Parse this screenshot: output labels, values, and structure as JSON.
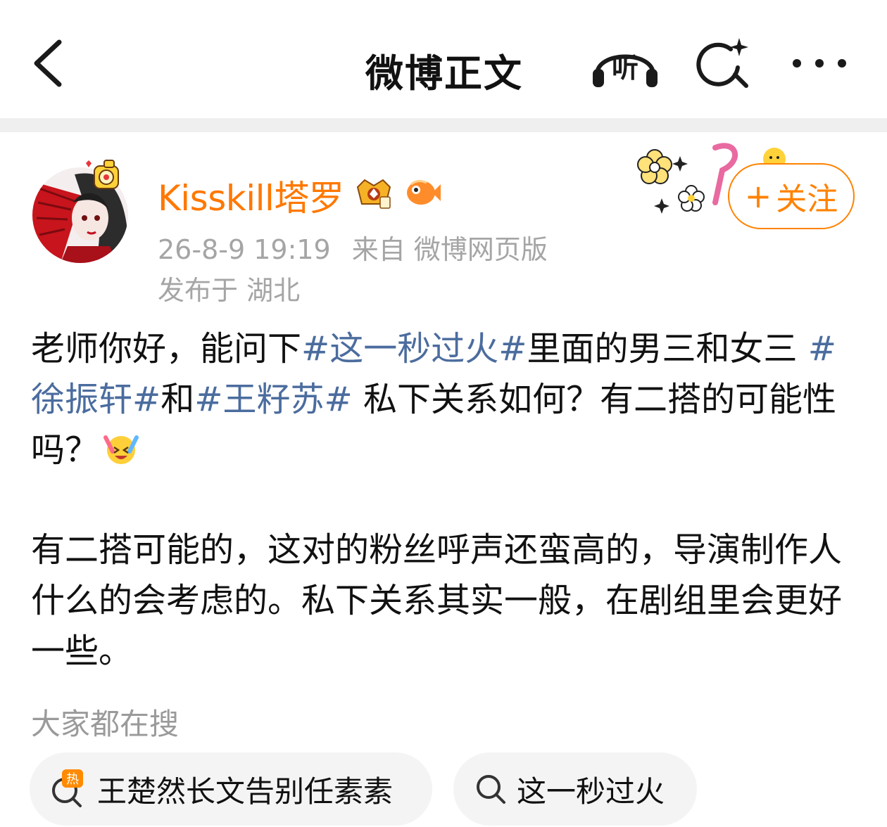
{
  "header": {
    "title": "微博正文",
    "listen_label": "听",
    "icons": [
      "back-arrow-icon",
      "headphones-listen-icon",
      "ai-search-icon",
      "more-dots-icon"
    ]
  },
  "author": {
    "name": "Kisskill塔罗",
    "timestamp": "26-8-9 19:19",
    "source": "来自 微博网页版",
    "location": "发布于 湖北",
    "follow_label": "关注",
    "follow_plus": "+",
    "name_color": "#ff7800"
  },
  "post": {
    "p1": [
      {
        "text": "老师你好，能问下",
        "tag": false
      },
      {
        "text": "#这一秒过火#",
        "tag": true
      },
      {
        "text": "里面的男三和女三 ",
        "tag": false
      },
      {
        "text": "#徐振轩#",
        "tag": true
      },
      {
        "text": "和",
        "tag": false
      },
      {
        "text": "#王籽苏#",
        "tag": true
      },
      {
        "text": " 私下关系如何？有二搭的可能性吗？",
        "tag": false
      }
    ],
    "p2": "有二搭可能的，这对的粉丝呼声还蛮高的，导演制作人什么的会考虑的。私下关系其实一般，在剧组里会更好一些。",
    "tag_color": "#4b6c9e"
  },
  "search": {
    "heading": "大家都在搜",
    "chips": [
      {
        "label": "王楚然长文告别任素素",
        "hot_badge": "热"
      },
      {
        "label": "这一秒过火"
      }
    ]
  }
}
